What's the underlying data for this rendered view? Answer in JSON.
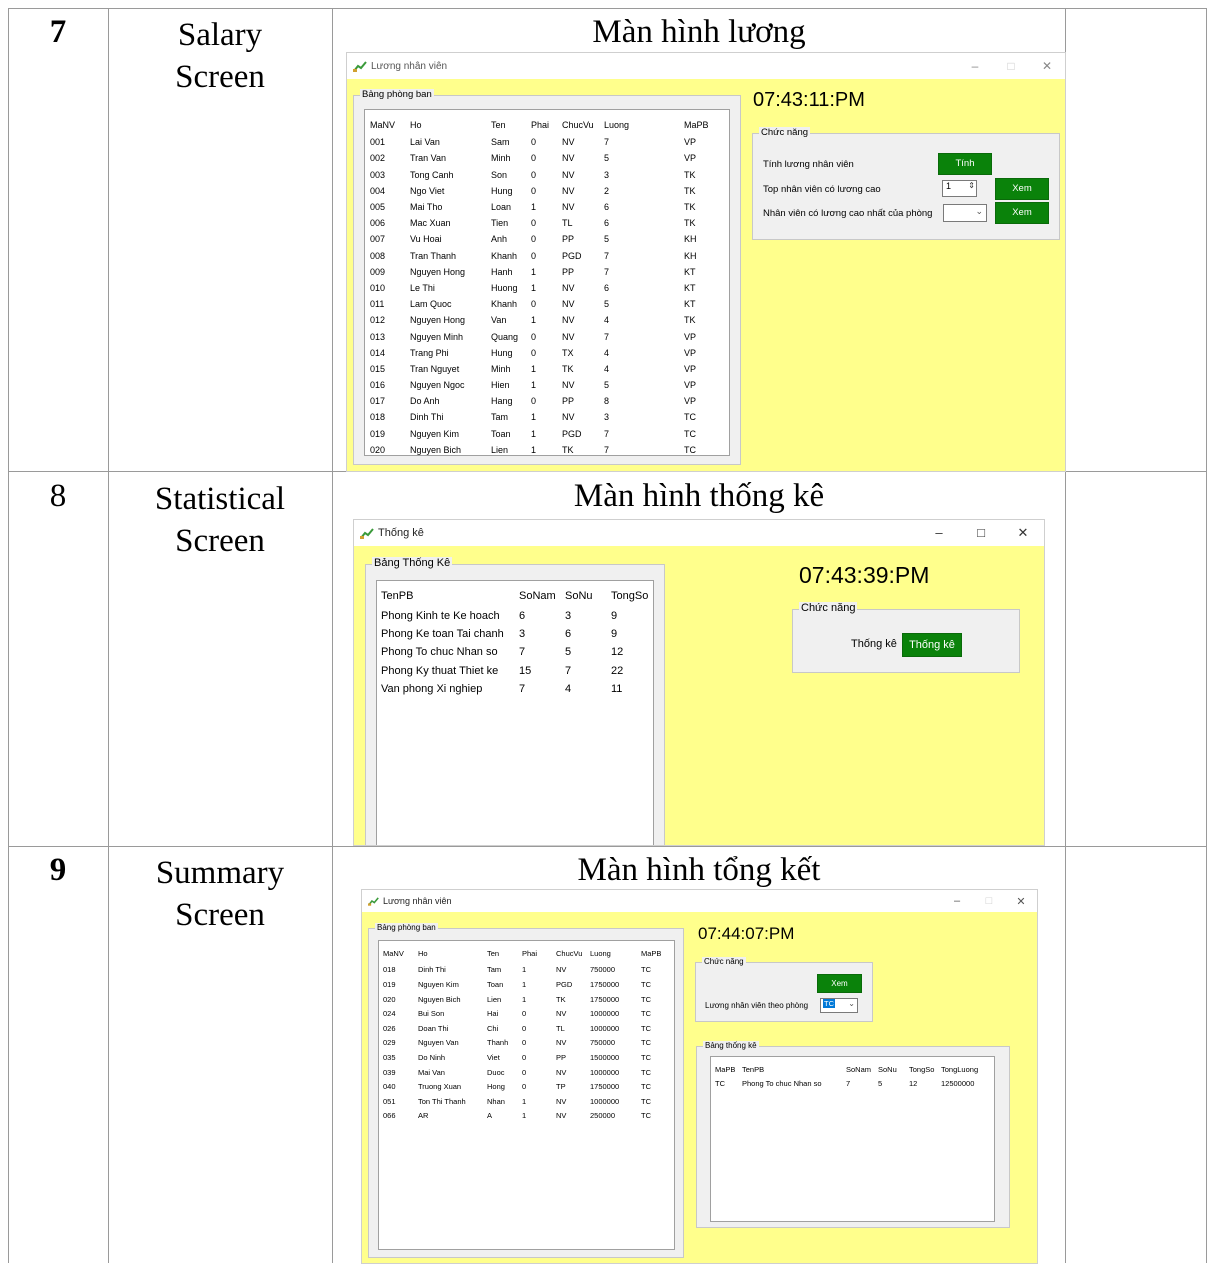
{
  "rows": [
    {
      "num": "7",
      "name": [
        "Salary",
        "Screen"
      ],
      "title": "Màn hình lương"
    },
    {
      "num": "8",
      "name": [
        "Statistical",
        "Screen"
      ],
      "title": "Màn hình thống kê"
    },
    {
      "num": "9",
      "name": [
        "Summary",
        "Screen"
      ],
      "title": "Màn hình tổng kết"
    }
  ],
  "salary": {
    "window_title": "Lương nhân viên",
    "group_title": "Bảng phòng ban",
    "clock": "07:43:11:PM",
    "func_group": "Chức năng",
    "columns": [
      "MaNV",
      "Ho",
      "Ten",
      "Phai",
      "ChucVu",
      "Luong",
      "MaPB"
    ],
    "rows": [
      [
        "001",
        "Lai Van",
        "Sam",
        "0",
        "NV",
        "7",
        "VP"
      ],
      [
        "002",
        "Tran Van",
        "Minh",
        "0",
        "NV",
        "5",
        "VP"
      ],
      [
        "003",
        "Tong Canh",
        "Son",
        "0",
        "NV",
        "3",
        "TK"
      ],
      [
        "004",
        "Ngo Viet",
        "Hung",
        "0",
        "NV",
        "2",
        "TK"
      ],
      [
        "005",
        "Mai Tho",
        "Loan",
        "1",
        "NV",
        "6",
        "TK"
      ],
      [
        "006",
        "Mac Xuan",
        "Tien",
        "0",
        "TL",
        "6",
        "TK"
      ],
      [
        "007",
        "Vu Hoai",
        "Anh",
        "0",
        "PP",
        "5",
        "KH"
      ],
      [
        "008",
        "Tran Thanh",
        "Khanh",
        "0",
        "PGD",
        "7",
        "KH"
      ],
      [
        "009",
        "Nguyen Hong",
        "Hanh",
        "1",
        "PP",
        "7",
        "KT"
      ],
      [
        "010",
        "Le Thi",
        "Huong",
        "1",
        "NV",
        "6",
        "KT"
      ],
      [
        "011",
        "Lam Quoc",
        "Khanh",
        "0",
        "NV",
        "5",
        "KT"
      ],
      [
        "012",
        "Nguyen Hong",
        "Van",
        "1",
        "NV",
        "4",
        "TK"
      ],
      [
        "013",
        "Nguyen Minh",
        "Quang",
        "0",
        "NV",
        "7",
        "VP"
      ],
      [
        "014",
        "Trang Phi",
        "Hung",
        "0",
        "TX",
        "4",
        "VP"
      ],
      [
        "015",
        "Tran Nguyet",
        "Minh",
        "1",
        "TK",
        "4",
        "VP"
      ],
      [
        "016",
        "Nguyen Ngoc",
        "Hien",
        "1",
        "NV",
        "5",
        "VP"
      ],
      [
        "017",
        "Do Anh",
        "Hang",
        "0",
        "PP",
        "8",
        "VP"
      ],
      [
        "018",
        "Dinh Thi",
        "Tam",
        "1",
        "NV",
        "3",
        "TC"
      ],
      [
        "019",
        "Nguyen Kim",
        "Toan",
        "1",
        "PGD",
        "7",
        "TC"
      ],
      [
        "020",
        "Nguyen Bich",
        "Lien",
        "1",
        "TK",
        "7",
        "TC"
      ]
    ],
    "func_rows": [
      {
        "label": "Tính lương nhân viên",
        "button": "Tính"
      },
      {
        "label": "Top nhân viên có lương cao",
        "spin_value": "1",
        "button": "Xem"
      },
      {
        "label": "Nhân viên có lương cao nhất của phòng",
        "button": "Xem"
      }
    ]
  },
  "stats": {
    "window_title": "Thống kê",
    "group_title": "Bảng Thống Kê",
    "clock": "07:43:39:PM",
    "func_group": "Chức năng",
    "func_label": "Thống kê",
    "button": "Thống kê",
    "columns": [
      "TenPB",
      "SoNam",
      "SoNu",
      "TongSo"
    ],
    "rows": [
      [
        "Phong Kinh te Ke hoach",
        "6",
        "3",
        "9"
      ],
      [
        "Phong Ke toan Tai chanh",
        "3",
        "6",
        "9"
      ],
      [
        "Phong To chuc Nhan so",
        "7",
        "5",
        "12"
      ],
      [
        "Phong Ky thuat Thiet ke",
        "15",
        "7",
        "22"
      ],
      [
        "Van phong Xi nghiep",
        "7",
        "4",
        "11"
      ]
    ]
  },
  "summary": {
    "window_title": "Lương nhân viên",
    "group_title": "Bảng phòng ban",
    "clock": "07:44:07:PM",
    "func_group": "Chức năng",
    "button": "Xem",
    "func_label": "Lương nhân viên theo phòng",
    "combo_value": "TC",
    "columns": [
      "MaNV",
      "Ho",
      "Ten",
      "Phai",
      "ChucVu",
      "Luong",
      "MaPB"
    ],
    "rows": [
      [
        "018",
        "Dinh Thi",
        "Tam",
        "1",
        "NV",
        "750000",
        "TC"
      ],
      [
        "019",
        "Nguyen Kim",
        "Toan",
        "1",
        "PGD",
        "1750000",
        "TC"
      ],
      [
        "020",
        "Nguyen Bich",
        "Lien",
        "1",
        "TK",
        "1750000",
        "TC"
      ],
      [
        "024",
        "Bui Son",
        "Hai",
        "0",
        "NV",
        "1000000",
        "TC"
      ],
      [
        "026",
        "Doan Thi",
        "Chi",
        "0",
        "TL",
        "1000000",
        "TC"
      ],
      [
        "029",
        "Nguyen Van",
        "Thanh",
        "0",
        "NV",
        "750000",
        "TC"
      ],
      [
        "035",
        "Do Ninh",
        "Viet",
        "0",
        "PP",
        "1500000",
        "TC"
      ],
      [
        "039",
        "Mai Van",
        "Duoc",
        "0",
        "NV",
        "1000000",
        "TC"
      ],
      [
        "040",
        "Truong Xuan",
        "Hong",
        "0",
        "TP",
        "1750000",
        "TC"
      ],
      [
        "051",
        "Ton Thi Thanh",
        "Nhan",
        "1",
        "NV",
        "1000000",
        "TC"
      ],
      [
        "066",
        "AR",
        "A",
        "1",
        "NV",
        "250000",
        "TC"
      ]
    ],
    "stat_group": "Bảng thống kê",
    "stat_columns": [
      "MaPB",
      "TenPB",
      "SoNam",
      "SoNu",
      "TongSo",
      "TongLuong"
    ],
    "stat_rows": [
      [
        "TC",
        "Phong To chuc Nhan so",
        "7",
        "5",
        "12",
        "12500000"
      ]
    ]
  },
  "icons": {
    "app": "chart-icon",
    "minimize": "minimize-icon",
    "maximize": "maximize-icon",
    "close": "close-icon"
  }
}
